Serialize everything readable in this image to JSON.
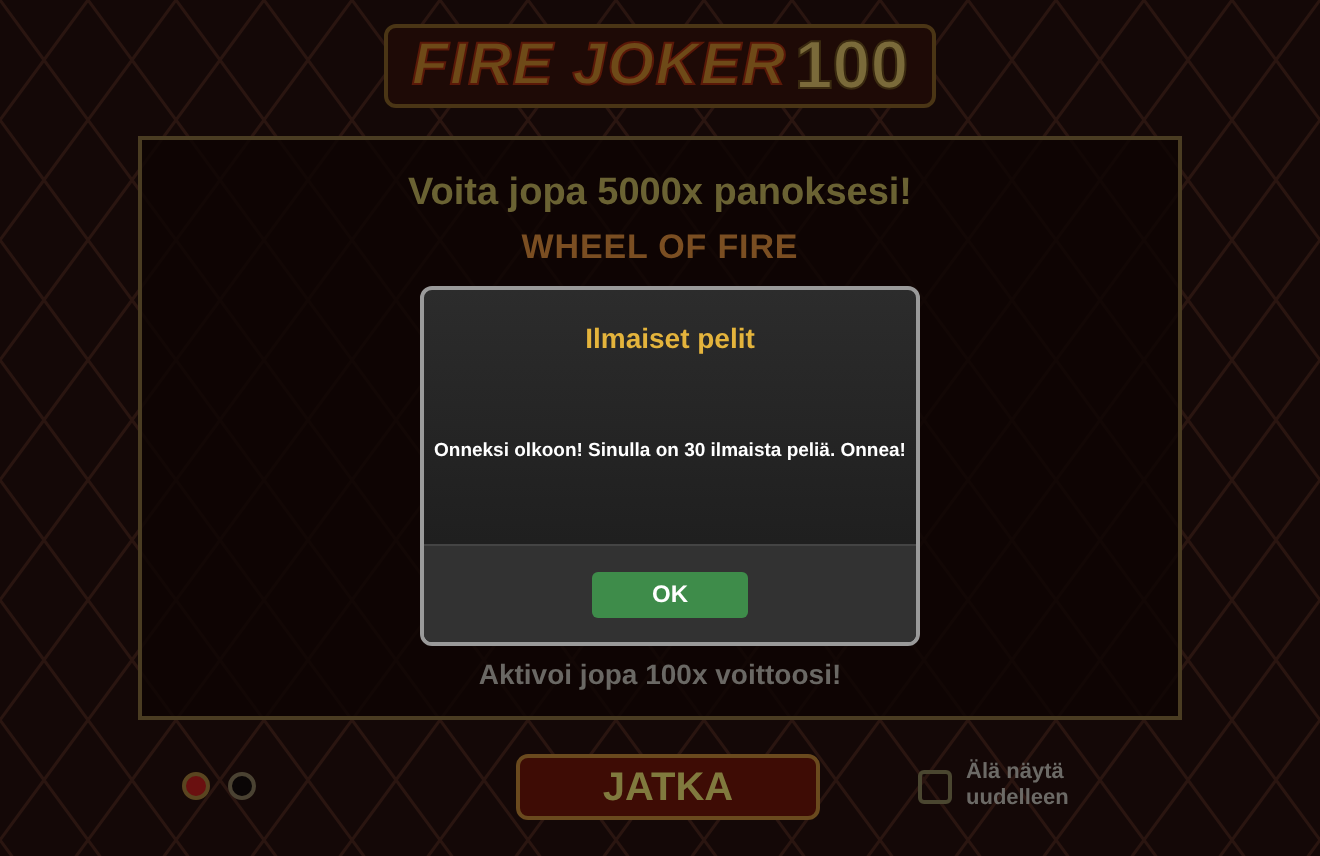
{
  "logo": {
    "text": "FIRE JOKER",
    "suffix": "100"
  },
  "panel": {
    "headline": "Voita jopa 5000x panoksesi!",
    "feature_title": "WHEEL OF FIRE",
    "footer_text": "Aktivoi jopa 100x voittoosi!"
  },
  "pages": [
    {
      "selected": true
    },
    {
      "selected": false
    }
  ],
  "continue_button": "JATKA",
  "dont_show_again": {
    "label": "Älä näytä uudelleen",
    "checked": false
  },
  "dialog": {
    "title": "Ilmaiset pelit",
    "message": "Onneksi olkoon!  Sinulla on 30 ilmaista peliä. Onnea!",
    "button": "OK"
  }
}
